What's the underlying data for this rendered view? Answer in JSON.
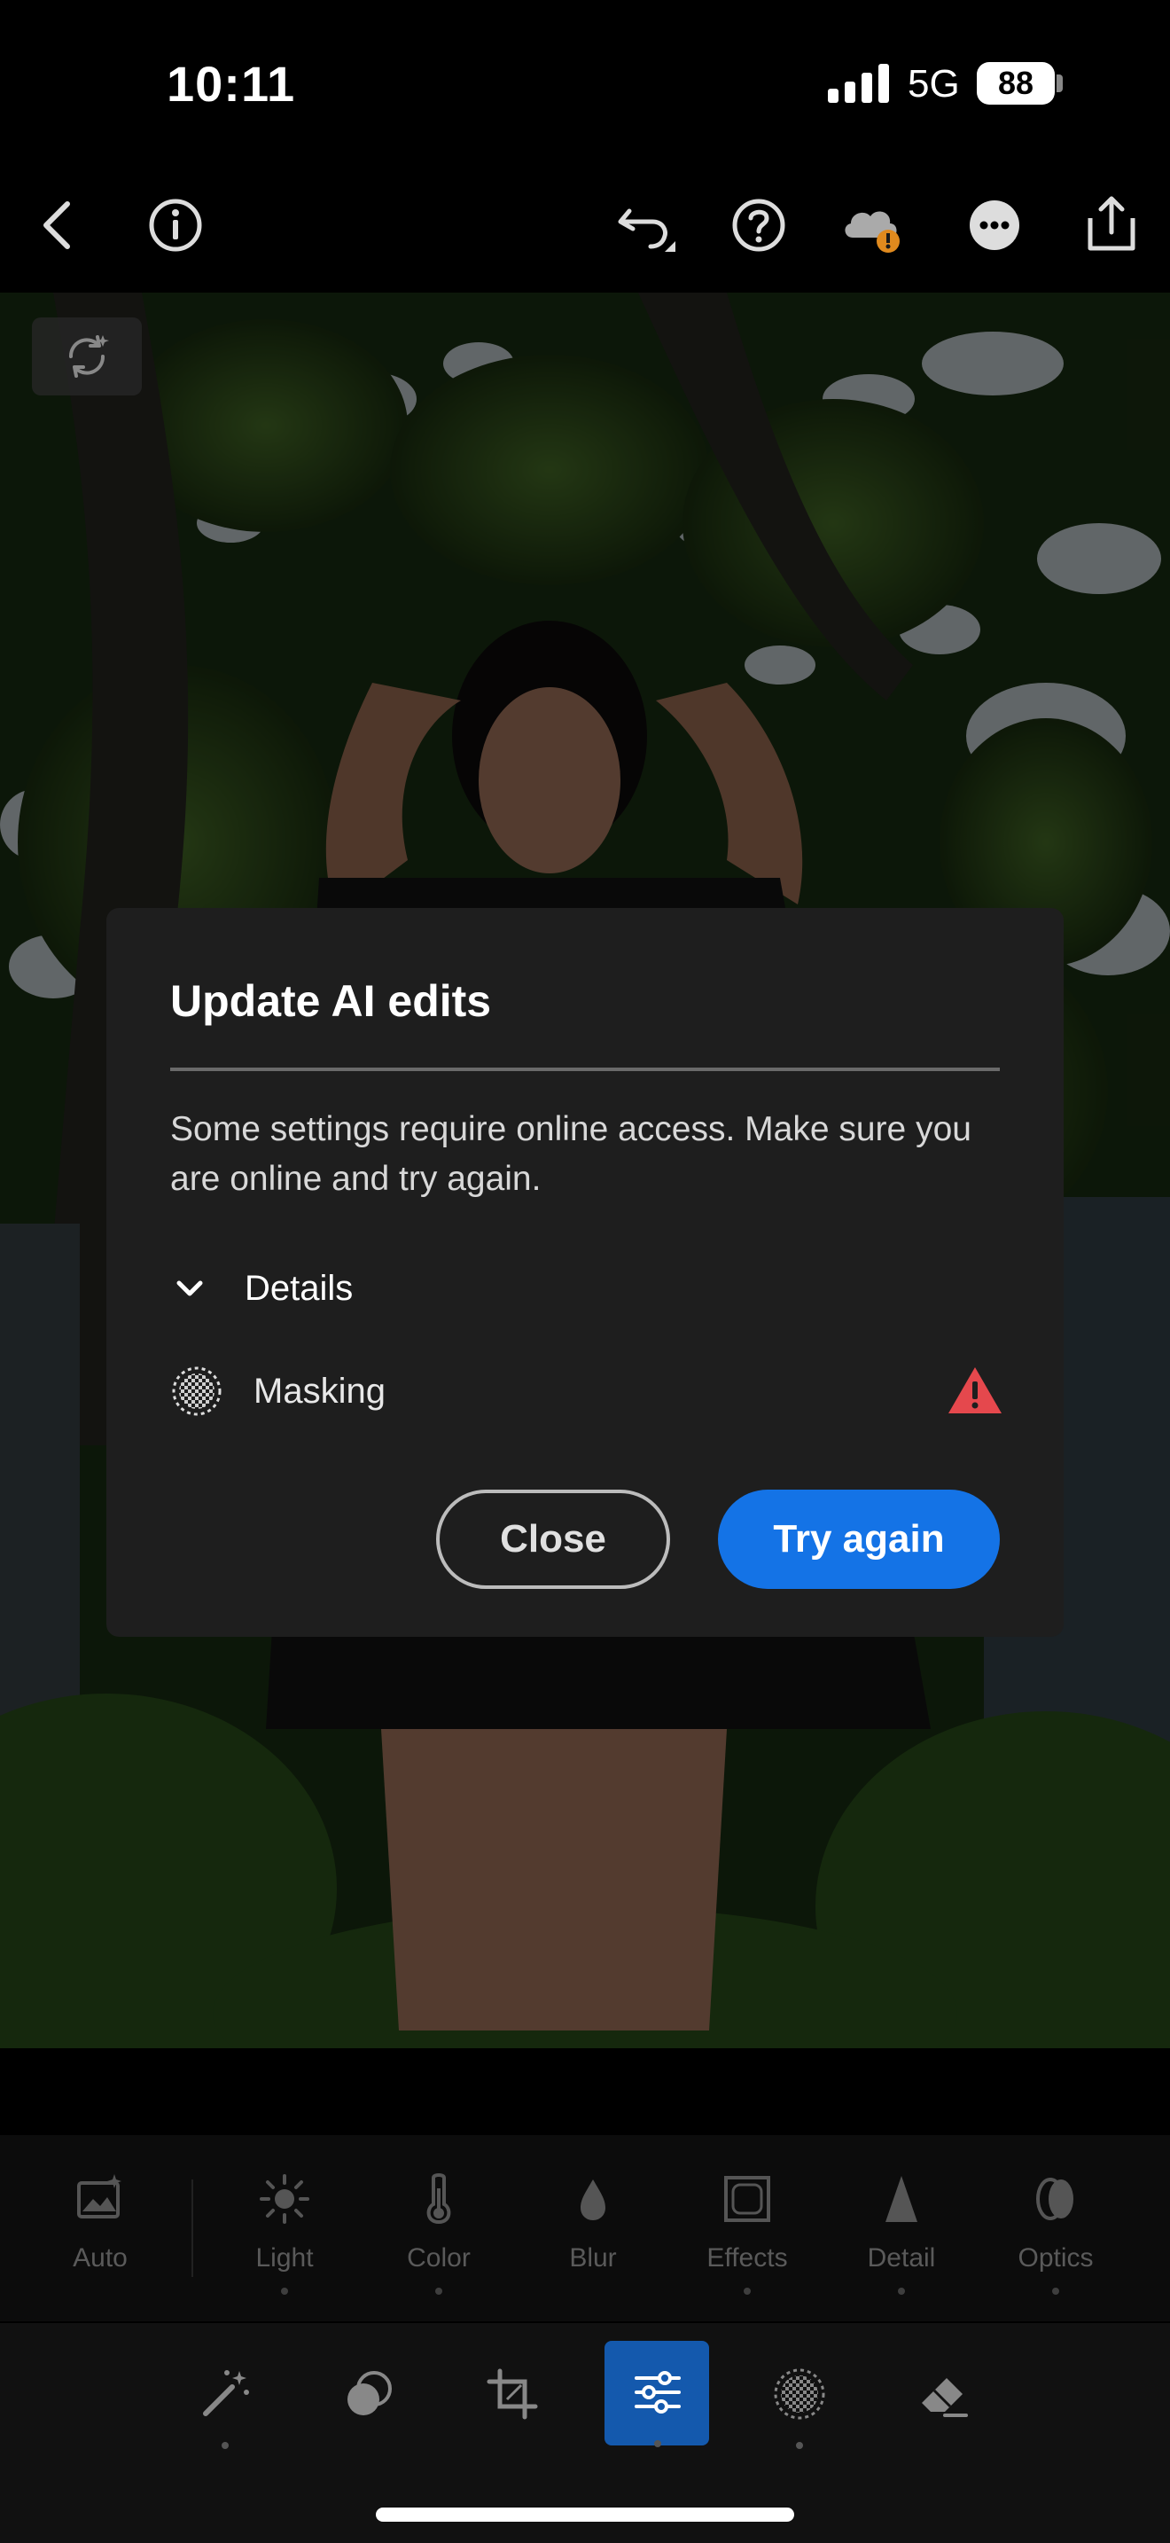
{
  "status_bar": {
    "time": "10:11",
    "network": "5G",
    "battery": "88"
  },
  "toolbar": {
    "icons": [
      "back-icon",
      "info-icon",
      "undo-icon",
      "help-icon",
      "cloud-warning-icon",
      "more-icon",
      "share-icon"
    ]
  },
  "dialog": {
    "title": "Update AI edits",
    "message": "Some settings require online access. Make sure you are online and try again.",
    "details_label": "Details",
    "item_label": "Masking",
    "close_label": "Close",
    "try_again_label": "Try again"
  },
  "adjustments": {
    "items": [
      {
        "label": "Auto",
        "icon": "auto-icon"
      },
      {
        "label": "Light",
        "icon": "light-icon"
      },
      {
        "label": "Color",
        "icon": "color-icon"
      },
      {
        "label": "Blur",
        "icon": "blur-icon"
      },
      {
        "label": "Effects",
        "icon": "effects-icon"
      },
      {
        "label": "Detail",
        "icon": "detail-icon"
      },
      {
        "label": "Optics",
        "icon": "optics-icon"
      }
    ]
  },
  "tools": {
    "items": [
      "quick-actions-icon",
      "presets-icon",
      "crop-icon",
      "edit-icon",
      "masking-icon",
      "remove-icon"
    ],
    "active": "edit-icon"
  },
  "colors": {
    "accent": "#1473e6",
    "warning": "#e5484d",
    "dialog_bg": "#1e1e1e"
  }
}
